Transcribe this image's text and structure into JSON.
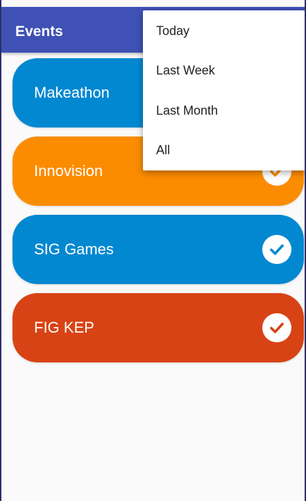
{
  "app_bar": {
    "title": "Events",
    "color": "#3f51b5"
  },
  "events": [
    {
      "label": "Makeathon",
      "color": "#0288d1",
      "checked": true,
      "icon": "check-circle-icon"
    },
    {
      "label": "Innovision",
      "color": "#fb8c00",
      "checked": true,
      "icon": "check-circle-icon"
    },
    {
      "label": "SIG Games",
      "color": "#0288d1",
      "checked": true,
      "icon": "check-circle-icon"
    },
    {
      "label": "FIG KEP",
      "color": "#d84315",
      "checked": true,
      "icon": "check-circle-icon"
    }
  ],
  "filter_menu": {
    "items": [
      {
        "label": "Today"
      },
      {
        "label": "Last Week"
      },
      {
        "label": "Last Month"
      },
      {
        "label": "All"
      }
    ]
  }
}
